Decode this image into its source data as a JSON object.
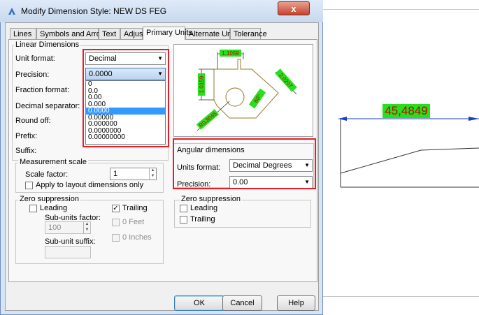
{
  "window": {
    "title": "Modify Dimension Style: NEW DS FEG",
    "close_label": "x"
  },
  "tabs": [
    {
      "label": "Lines"
    },
    {
      "label": "Symbols and Arrows"
    },
    {
      "label": "Text"
    },
    {
      "label": "Adjust"
    },
    {
      "label": "Primary Units",
      "active": true
    },
    {
      "label": "Alternate Units"
    },
    {
      "label": "Tolerance"
    }
  ],
  "linear": {
    "group_title": "Linear Dimensions",
    "unit_format_label": "Unit format:",
    "unit_format_value": "Decimal",
    "precision_label": "Precision:",
    "precision_value": "0.0000",
    "precision_options": [
      "0",
      "0.0",
      "0.00",
      "0.000",
      "0.0000",
      "0.00000",
      "0.000000",
      "0.0000000",
      "0.00000000"
    ],
    "precision_selected_index": 4,
    "fraction_format_label": "Fraction format:",
    "decimal_separator_label": "Decimal separator:",
    "round_off_label": "Round off:",
    "prefix_label": "Prefix:",
    "suffix_label": "Suffix:"
  },
  "measurement": {
    "group_title": "Measurement scale",
    "scale_factor_label": "Scale factor:",
    "scale_factor_value": "1",
    "apply_layout_label": "Apply to layout dimensions only"
  },
  "zero_linear": {
    "group_title": "Zero suppression",
    "leading_label": "Leading",
    "trailing_label": "Trailing",
    "trailing_checked": true,
    "subunits_factor_label": "Sub-units factor:",
    "subunits_factor_value": "100",
    "zero_feet_label": "0 Feet",
    "zero_inches_label": "0 Inches",
    "subunit_suffix_label": "Sub-unit suffix:"
  },
  "preview": {
    "dim_top": "1.1059",
    "dim_left": "1.0159",
    "dim_right": "2.0207",
    "dim_bottom": "R0.8045",
    "dim_angle": "60°"
  },
  "angular": {
    "group_title": "Angular dimensions",
    "units_format_label": "Units format:",
    "units_format_value": "Decimal Degrees",
    "precision_label": "Precision:",
    "precision_value": "0.00"
  },
  "zero_angular": {
    "group_title": "Zero suppression",
    "leading_label": "Leading",
    "trailing_label": "Trailing"
  },
  "buttons": {
    "ok": "OK",
    "cancel": "Cancel",
    "help": "Help"
  },
  "drawing": {
    "dimension_text": "45,4849"
  },
  "colors": {
    "highlight_box": "#e0202a",
    "selection": "#3399ff",
    "dim_text_bg": "#25e01a",
    "dim_text_fg": "#c80000"
  }
}
